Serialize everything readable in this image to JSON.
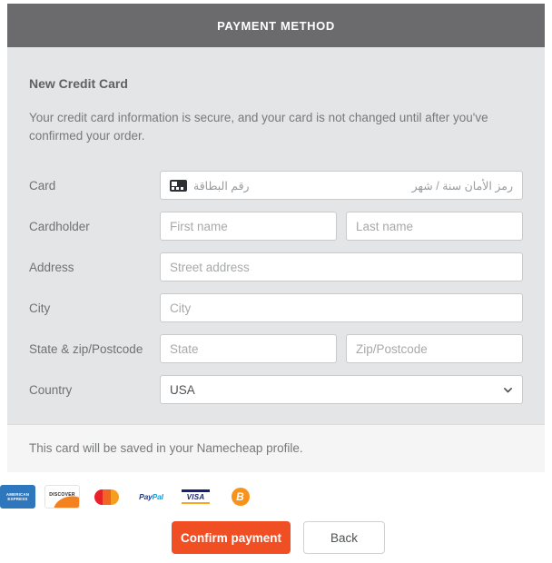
{
  "panel": {
    "header_title": "PAYMENT METHOD",
    "section_title": "New Credit Card",
    "intro_text": "Your credit card information is secure, and your card is not changed until after you've confirmed your order.",
    "note_text": "This card will be saved in your Namecheap profile."
  },
  "form": {
    "card": {
      "label": "Card",
      "icon": "credit-card-icon",
      "number_placeholder": "رقم البطاقة",
      "expiry_cvc_placeholder": "رمز الأمان  سنة / شهر"
    },
    "cardholder": {
      "label": "Cardholder",
      "first_name_placeholder": "First name",
      "first_name_value": "",
      "last_name_placeholder": "Last name",
      "last_name_value": ""
    },
    "address": {
      "label": "Address",
      "placeholder": "Street address",
      "value": ""
    },
    "city": {
      "label": "City",
      "placeholder": "City",
      "value": ""
    },
    "state_zip": {
      "label": "State & zip/Postcode",
      "state_placeholder": "State",
      "state_value": "",
      "zip_placeholder": "Zip/Postcode",
      "zip_value": ""
    },
    "country": {
      "label": "Country",
      "selected": "USA",
      "chevron": "chevron-down-icon"
    }
  },
  "brands": [
    {
      "name": "american-express",
      "line1": "AMERICAN",
      "line2": "EXPRESS",
      "color": "#2e77bc"
    },
    {
      "name": "discover",
      "text": "DISCOVER",
      "color": "#f48120"
    },
    {
      "name": "mastercard",
      "text": "",
      "color": "#e8202a"
    },
    {
      "name": "paypal",
      "text_pay": "Pay",
      "text_pal": "Pal",
      "color": "#253b80"
    },
    {
      "name": "visa",
      "text": "VISA",
      "color": "#1a1f71"
    },
    {
      "name": "bitcoin",
      "text": "B",
      "color": "#f7931a"
    }
  ],
  "actions": {
    "confirm_label": "Confirm payment",
    "back_label": "Back",
    "confirm_color": "#f04e23"
  }
}
